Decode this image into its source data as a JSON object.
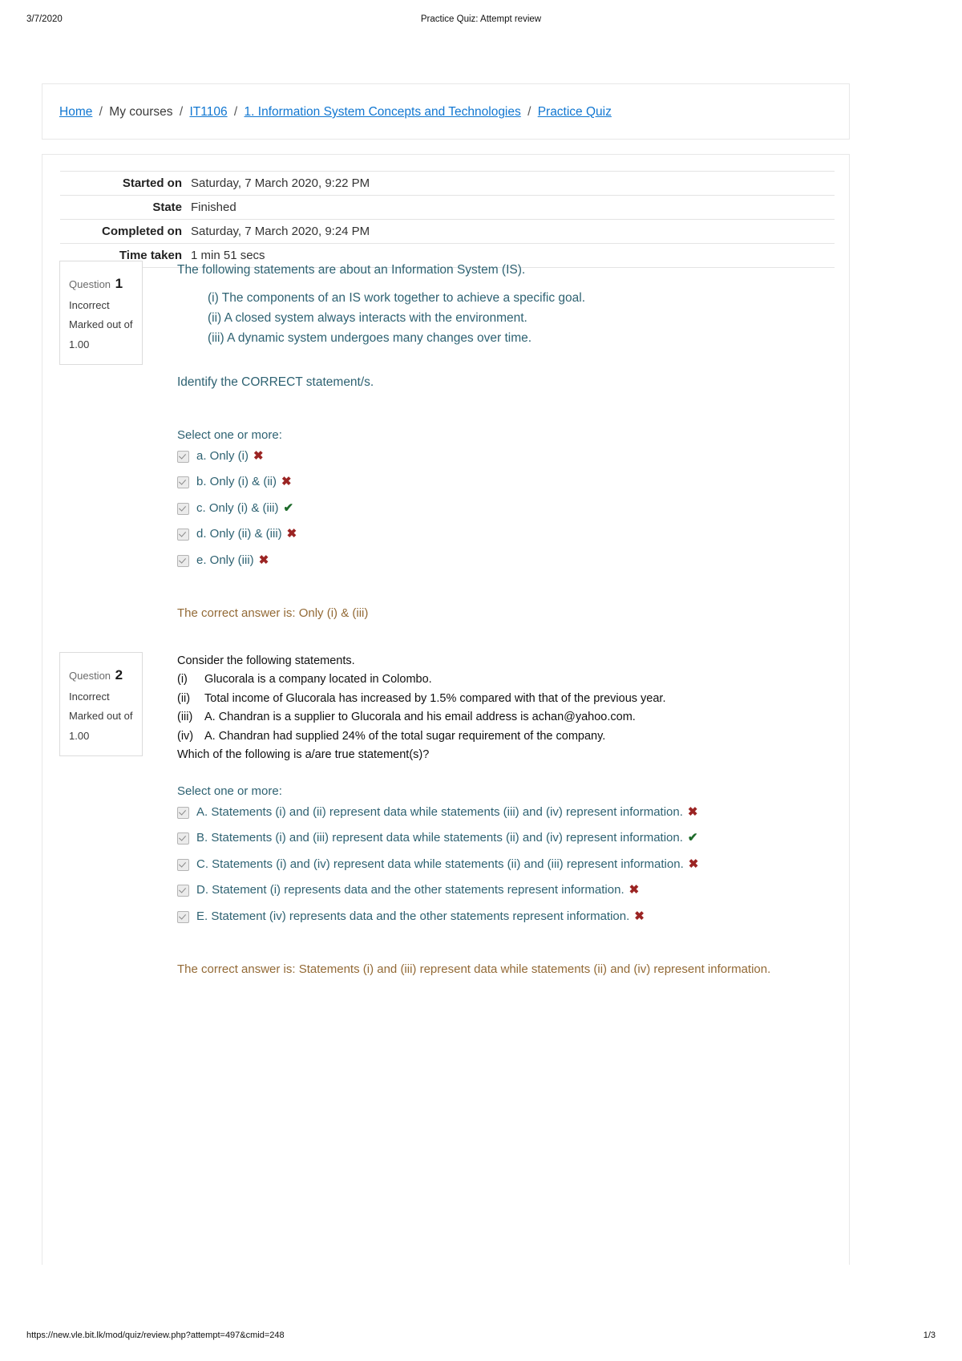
{
  "print_header": {
    "date": "3/7/2020",
    "title": "Practice Quiz: Attempt review"
  },
  "print_footer": {
    "url": "https://new.vle.bit.lk/mod/quiz/review.php?attempt=497&cmid=248",
    "page": "1/3"
  },
  "breadcrumb": {
    "items": [
      {
        "label": "Home",
        "link": true
      },
      {
        "label": "My courses",
        "link": false
      },
      {
        "label": "IT1106",
        "link": true
      },
      {
        "label": "1. Information System Concepts and Technologies",
        "link": true
      },
      {
        "label": "Practice Quiz",
        "link": true
      }
    ],
    "separator": "/"
  },
  "summary": {
    "rows": [
      {
        "label": "Started on",
        "value": "Saturday, 7 March 2020, 9:22 PM"
      },
      {
        "label": "State",
        "value": "Finished"
      },
      {
        "label": "Completed on",
        "value": "Saturday, 7 March 2020, 9:24 PM"
      },
      {
        "label": "Time taken",
        "value": "1 min 51 secs"
      }
    ]
  },
  "questions": [
    {
      "info": {
        "question_word": "Question",
        "number": "1",
        "state": "Incorrect",
        "marked_out_of": "Marked out of 1.00"
      },
      "intro": "The following statements are about an Information System (IS).",
      "statements": [
        "(i) The components of an IS work together to achieve a specific goal.",
        "(ii) A closed system always interacts with the environment.",
        "(iii) A dynamic system undergoes many changes over time."
      ],
      "prompt": "Identify the CORRECT statement/s.",
      "select_label": "Select one or more:",
      "options": [
        {
          "text": "a. Only (i)",
          "mark": "wrong",
          "glyph": "✖"
        },
        {
          "text": "b. Only (i) & (ii)",
          "mark": "wrong",
          "glyph": "✖"
        },
        {
          "text": "c. Only (i) & (iii)",
          "mark": "right",
          "glyph": "✔"
        },
        {
          "text": "d. Only (ii) & (iii)",
          "mark": "wrong",
          "glyph": "✖"
        },
        {
          "text": "e. Only (iii)",
          "mark": "wrong",
          "glyph": "✖"
        }
      ],
      "correct_answer": "The correct answer is: Only (i) & (iii)"
    },
    {
      "info": {
        "question_word": "Question",
        "number": "2",
        "state": "Incorrect",
        "marked_out_of": "Marked out of 1.00"
      },
      "intro": "Consider the following statements.",
      "statements": [
        {
          "num": "(i)",
          "text": "Glucorala is a company located in Colombo."
        },
        {
          "num": "(ii)",
          "text": "Total income of Glucorala has increased by 1.5% compared with that of the previous year."
        },
        {
          "num": "(iii)",
          "text": "A. Chandran is a supplier to Glucorala and his email address is achan@yahoo.com."
        },
        {
          "num": "(iv)",
          "text": "A. Chandran had supplied 24% of the total sugar requirement of the company."
        }
      ],
      "prompt": "Which of the following is a/are true statement(s)?",
      "select_label": "Select one or more:",
      "options": [
        {
          "text": "A. Statements (i) and (ii) represent data while statements (iii) and (iv) represent information.",
          "mark": "wrong",
          "glyph": "✖"
        },
        {
          "text": "B. Statements (i) and (iii) represent data while statements (ii) and (iv) represent information.",
          "mark": "right",
          "glyph": "✔"
        },
        {
          "text": "C. Statements (i) and (iv) represent data while statements (ii) and (iii) represent information.",
          "mark": "wrong",
          "glyph": "✖"
        },
        {
          "text": "D. Statement (i) represents data and the other statements represent information.",
          "mark": "wrong",
          "glyph": "✖"
        },
        {
          "text": "E. Statement (iv) represents data and the other statements represent information.",
          "mark": "wrong",
          "glyph": "✖"
        }
      ],
      "correct_answer": "The correct answer is: Statements (i) and (iii) represent data while statements (ii) and (iv) represent information."
    }
  ],
  "colors": {
    "link": "#1177d1",
    "question_text": "#2e6272",
    "correct_answer_text": "#936a36",
    "wrong_mark": "#9b2423",
    "right_mark": "#1d6b2a"
  }
}
